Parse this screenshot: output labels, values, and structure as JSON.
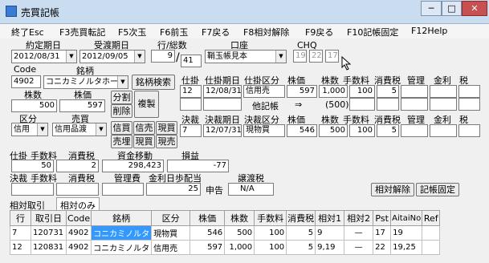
{
  "window": {
    "title": "売買記帳",
    "minimize": "─",
    "maximize": "□",
    "close": "✕"
  },
  "menu": [
    "終了Esc",
    "F3売買転記",
    "F5次玉",
    "F6前玉",
    "F7戻る",
    "F8相対解除",
    "F9戻る",
    "F10記帳固定",
    "F12Help"
  ],
  "form": {
    "contract_date_label": "約定期日",
    "contract_date": "2012/08/31",
    "settle_date_label": "受渡期日",
    "settle_date": "2012/09/05",
    "row_label": "行/総数",
    "row_value": "9",
    "total_value": "41",
    "account_label": "口座",
    "account_value": "鞘玉帳見本",
    "chq_label": "CHQ",
    "chq1": "19",
    "chq2": "22",
    "chq3": "17",
    "code_label": "Code",
    "code": "4902",
    "name_label": "銘柄",
    "name": "コニカミノルタホー",
    "search_btn": "銘柄検索",
    "qty_label": "株数",
    "qty": "500",
    "price_label": "株価",
    "price": "597",
    "split_btn": "分割",
    "delete_btn": "削除",
    "copy_btn": "複製",
    "kubun_label": "区分",
    "kubun": "信用",
    "baibai_label": "売買",
    "baibai": "信用品渡",
    "btn_shinkai": "信買",
    "btn_shinuri": "信売",
    "btn_genkai": "現買",
    "btn_baiuri": "売埋",
    "btn_genbai": "現買",
    "btn_genbai2": "現売"
  },
  "open_section": {
    "headers": [
      "仕掛",
      "仕掛期日",
      "仕掛区分",
      "株価",
      "株数",
      "手数料",
      "消費税",
      "管理",
      "金利",
      "税"
    ],
    "row": [
      "12",
      "12/08/31",
      "信用売",
      "597",
      "1,000",
      "100",
      "5"
    ],
    "row2_mid": "他記帳",
    "row2_arrow": "⇒",
    "row2_qty": "(500)"
  },
  "close_section": {
    "headers": [
      "決裁",
      "決裁期日",
      "決裁区分",
      "株価",
      "株数",
      "手数料",
      "消費税",
      "管理",
      "金利",
      "税"
    ],
    "row": [
      "7",
      "12/07/31",
      "現物買",
      "546",
      "500",
      "100",
      "5"
    ]
  },
  "summary": {
    "open_label": "仕掛",
    "fee_label": "手数料",
    "tax_label": "消費税",
    "transfer_label": "資金移動",
    "pl_label": "損益",
    "fee": "50",
    "tax": "2",
    "transfer": "298,423",
    "pl": "-77",
    "close_label": "決裁",
    "fee2_label": "手数料",
    "tax2_label": "消費税",
    "mgmt_label": "管理費",
    "interest_label": "金利日歩配当",
    "transfer_tax_label": "譲渡税",
    "interest": "25",
    "declared": "申告",
    "transfer_tax": "N/A",
    "release_btn": "相対解除",
    "fix_btn": "記帳固定"
  },
  "tabs": {
    "tab1": "相対取引",
    "tab2": "相対のみ"
  },
  "table": {
    "headers": [
      "行",
      "取引日",
      "Code",
      "銘柄",
      "区分",
      "株価",
      "株数",
      "手数料",
      "消費税",
      "相対1",
      "相対2",
      "Pst",
      "AitaiNo",
      "Ref"
    ],
    "rows": [
      [
        "7",
        "120731",
        "4902",
        "コニカミノルタ",
        "現物買",
        "546",
        "500",
        "100",
        "5",
        "9",
        "—",
        "17",
        "19",
        ""
      ],
      [
        "12",
        "120831",
        "4902",
        "コニカミノルタ",
        "信用売",
        "597",
        "1,000",
        "100",
        "5",
        "9,19",
        "—",
        "22",
        "19,25",
        ""
      ]
    ]
  }
}
